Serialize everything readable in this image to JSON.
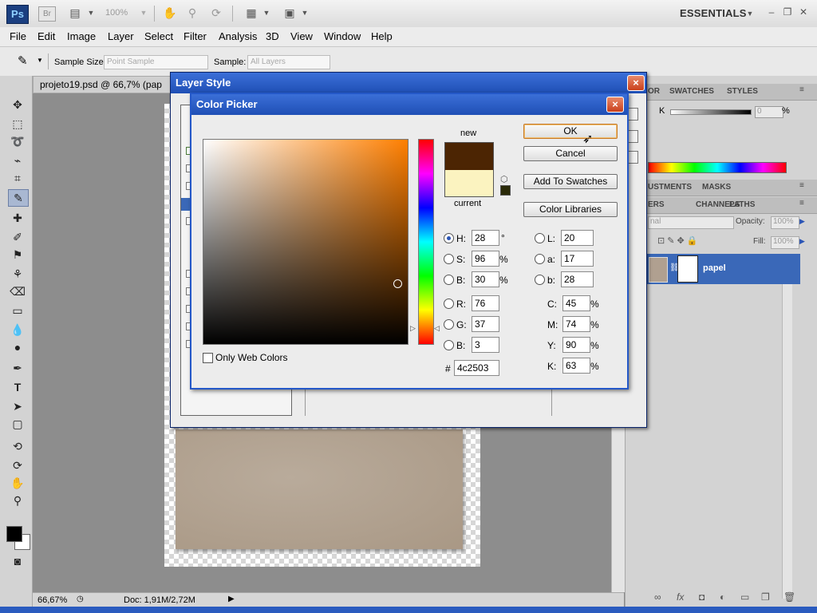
{
  "app": {
    "logo": "Ps",
    "bridge": "Br",
    "zoom": "100%",
    "workspace": "ESSENTIALS"
  },
  "menu": [
    "File",
    "Edit",
    "Image",
    "Layer",
    "Select",
    "Filter",
    "Analysis",
    "3D",
    "View",
    "Window",
    "Help"
  ],
  "options": {
    "sample_size_label": "Sample Size:",
    "sample_size_value": "Point Sample",
    "sample_label": "Sample:",
    "sample_value": "All Layers"
  },
  "document": {
    "tab_title": "projeto19.psd @ 66,7% (pap",
    "zoom": "66,67%",
    "doc_size": "Doc: 1,91M/2,72M"
  },
  "panels": {
    "color_tabs": [
      "OR",
      "SWATCHES",
      "STYLES"
    ],
    "k_label": "K",
    "k_value": "0",
    "k_unit": "%",
    "adjust_tabs": [
      "USTMENTS",
      "MASKS"
    ],
    "layer_tabs": [
      "ERS",
      "CHANNELS",
      "PATHS"
    ],
    "blend_mode": "nal",
    "opacity_label": "Opacity:",
    "opacity_value": "100%",
    "fill_label": "Fill:",
    "fill_value": "100%",
    "layer_name": "papel"
  },
  "layer_style": {
    "title": "Layer Style",
    "close": "×"
  },
  "color_picker": {
    "title": "Color Picker",
    "close": "×",
    "new_label": "new",
    "current_label": "current",
    "new_color": "#4c2503",
    "current_color": "#fbf3c0",
    "buttons": {
      "ok": "OK",
      "cancel": "Cancel",
      "add_to_swatches": "Add To Swatches",
      "color_libraries": "Color Libraries"
    },
    "only_web_colors": "Only Web Colors",
    "hsb": {
      "h_label": "H:",
      "h_value": "28",
      "h_unit": "°",
      "s_label": "S:",
      "s_value": "96",
      "s_unit": "%",
      "b_label": "B:",
      "b_value": "30",
      "b_unit": "%"
    },
    "rgb": {
      "r_label": "R:",
      "r_value": "76",
      "g_label": "G:",
      "g_value": "37",
      "b_label": "B:",
      "b_value": "3"
    },
    "lab": {
      "l_label": "L:",
      "l_value": "20",
      "a_label": "a:",
      "a_value": "17",
      "b_label": "b:",
      "b_value": "28"
    },
    "cmyk": {
      "c_label": "C:",
      "c_value": "45",
      "c_unit": "%",
      "m_label": "M:",
      "m_value": "74",
      "m_unit": "%",
      "y_label": "Y:",
      "y_value": "90",
      "y_unit": "%",
      "k_label": "K:",
      "k_value": "63",
      "k_unit": "%"
    },
    "hex_label": "#",
    "hex_value": "4c2503"
  }
}
